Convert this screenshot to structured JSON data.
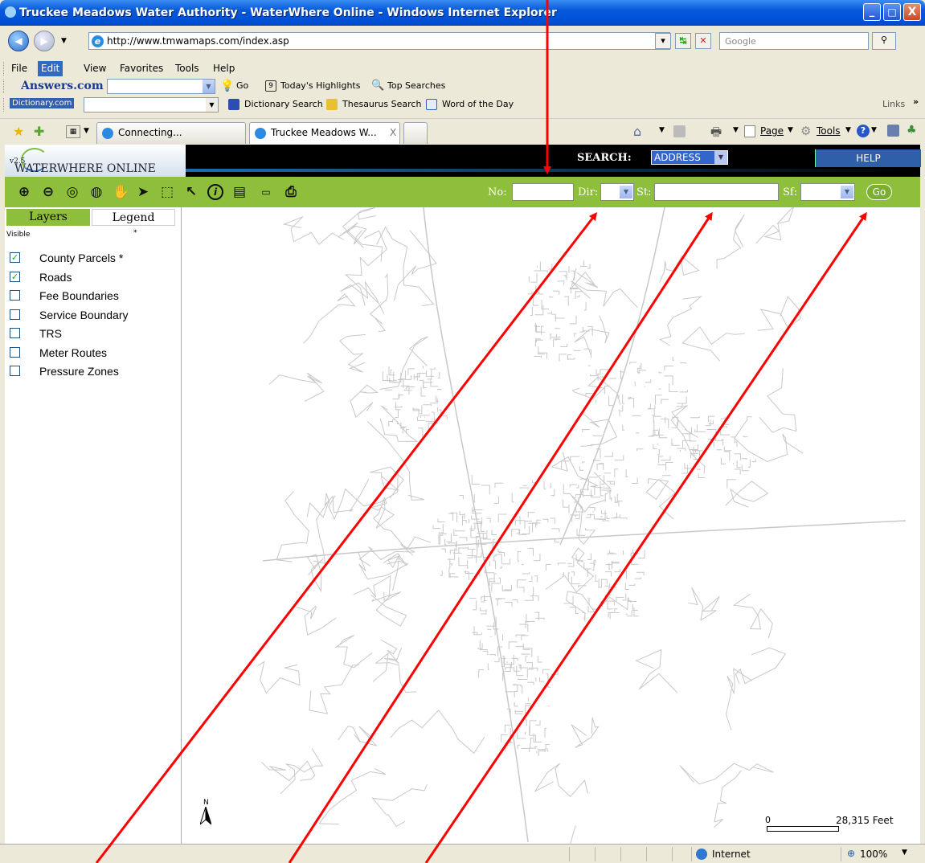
{
  "window": {
    "title": "Truckee Meadows Water Authority - WaterWhere Online - Windows Internet Explorer",
    "min": "_",
    "max": "□",
    "close": "X"
  },
  "address_bar": {
    "url": "http://www.tmwamaps.com/index.asp",
    "search_placeholder": "Google"
  },
  "menu": [
    "File",
    "Edit",
    "View",
    "Favorites",
    "Tools",
    "Help"
  ],
  "answers_toolbar": {
    "brand": "Answers.com",
    "go": "Go",
    "todays_highlights": "Today's Highlights",
    "top_searches": "Top Searches"
  },
  "dictionary_toolbar": {
    "brand": "Dictionary.com",
    "dictionary_search": "Dictionary Search",
    "thesaurus_search": "Thesaurus Search",
    "word_of_the_day": "Word of the Day",
    "links": "Links"
  },
  "tabs": [
    {
      "label": "Connecting..."
    },
    {
      "label": "Truckee Meadows W...",
      "close": "X"
    }
  ],
  "command_bar": {
    "page": "Page",
    "tools": "Tools"
  },
  "site": {
    "logo": "WATERWHERE ONLINE",
    "version": "v2.5",
    "search_label": "SEARCH:",
    "search_mode": "ADDRESS",
    "help": "HELP",
    "fields": {
      "no": "No:",
      "dir": "Dir:",
      "st": "St:",
      "sf": "Sf:",
      "go": "Go"
    }
  },
  "layers_panel": {
    "tab_layers": "Layers",
    "tab_legend": "Legend",
    "visible": "Visible",
    "star": "*",
    "items": [
      {
        "label": "County Parcels *",
        "checked": true,
        "mark": "✓"
      },
      {
        "label": "Roads",
        "checked": true,
        "mark": "✓"
      },
      {
        "label": "Fee Boundaries",
        "checked": false,
        "mark": ""
      },
      {
        "label": "Service Boundary",
        "checked": false,
        "mark": ""
      },
      {
        "label": "TRS",
        "checked": false,
        "mark": ""
      },
      {
        "label": "Meter Routes",
        "checked": false,
        "mark": ""
      },
      {
        "label": "Pressure Zones",
        "checked": false,
        "mark": ""
      }
    ]
  },
  "map": {
    "north": "N",
    "scale_zero": "0",
    "scale_value": "28,315 Feet"
  },
  "status_bar": {
    "zone": "Internet",
    "zoom": "100%"
  },
  "colors": {
    "site_green": "#8DBF3C",
    "help_blue": "#2E5FA8",
    "annotation_red": "#FF0000"
  }
}
